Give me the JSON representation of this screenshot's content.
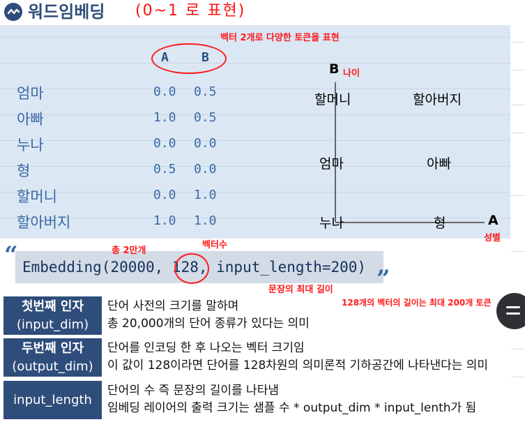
{
  "title": {
    "text": "워드임베딩",
    "note": "(0~1 로 표현)"
  },
  "annotations": {
    "vector_note": "벡터 2개로 다양한 토큰을 표현",
    "age_label": "나이",
    "gender_label": "성별",
    "total_vocab": "총 2만개",
    "vector_count": "벡터수",
    "max_len": "문장의 최대 길이",
    "len_note": "128개의 벡터의 길이는 최대 200개 토큰"
  },
  "table": {
    "headers": [
      "A",
      "B"
    ],
    "rows": [
      {
        "word": "엄마",
        "a": "0.0",
        "b": "0.5"
      },
      {
        "word": "아빠",
        "a": "1.0",
        "b": "0.5"
      },
      {
        "word": "누나",
        "a": "0.0",
        "b": "0.0"
      },
      {
        "word": "형",
        "a": "0.5",
        "b": "0.0"
      },
      {
        "word": "할머니",
        "a": "0.0",
        "b": "1.0"
      },
      {
        "word": "할아버지",
        "a": "1.0",
        "b": "1.0"
      }
    ]
  },
  "plot": {
    "y_axis": "B",
    "x_axis": "A",
    "points": [
      "할머니",
      "할아버지",
      "엄마",
      "아빠",
      "누나",
      "형"
    ]
  },
  "code": {
    "text": "Embedding(20000, 128, input_length=200)",
    "open_quote": "“",
    "close_quote": "”"
  },
  "params": [
    {
      "name": "첫번째 인자",
      "sub": "(input_dim)",
      "desc1": "단어 사전의 크기를 말하며",
      "desc2": "총 20,000개의 단어 종류가 있다는 의미"
    },
    {
      "name": "두번째 인자",
      "sub": "(output_dim)",
      "desc1": "단어를 인코딩 한 후 나오는 벡터 크기임",
      "desc2": "이 값이 128이라면 단어를 128차원의 의미론적 기하공간에 나타낸다는 의미"
    },
    {
      "name": "input_length",
      "sub": "",
      "desc1": "단어의 수 즉 문장의 길이를 나타냄",
      "desc2": "임베딩 레이어의 출력 크기는 샘플 수 * output_dim * input_lenth가 됨"
    }
  ],
  "colors": {
    "accent": "#2f4d7b",
    "panel": "#dce7f4",
    "annotation": "#ff1a1a",
    "fab": "#2e3033"
  },
  "icons": {
    "title_icon": "wave-circle-icon",
    "fab_icon": "menu-icon"
  }
}
